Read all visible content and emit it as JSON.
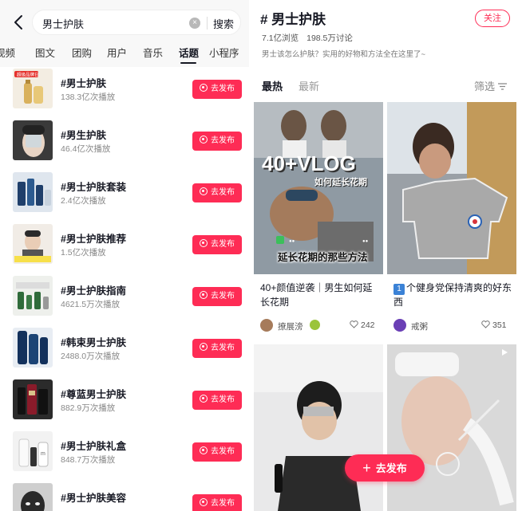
{
  "search": {
    "query": "男士护肤",
    "clear_icon": "clear-icon",
    "submit_label": "搜索"
  },
  "tabs": [
    "视频",
    "图文",
    "团购",
    "用户",
    "音乐",
    "话题",
    "小程序"
  ],
  "active_tab": "话题",
  "topics": [
    {
      "title": "#男士护肤",
      "plays": "138.3亿次播放",
      "button": "去发布"
    },
    {
      "title": "#男生护肤",
      "plays": "46.4亿次播放",
      "button": "去发布"
    },
    {
      "title": "#男士护肤套装",
      "plays": "2.4亿次播放",
      "button": "去发布"
    },
    {
      "title": "#男士护肤推荐",
      "plays": "1.5亿次播放",
      "button": "去发布"
    },
    {
      "title": "#男士护肤指南",
      "plays": "4621.5万次播放",
      "button": "去发布"
    },
    {
      "title": "#韩束男士护肤",
      "plays": "2488.0万次播放",
      "button": "去发布"
    },
    {
      "title": "#尊蓝男士护肤",
      "plays": "882.9万次播放",
      "button": "去发布"
    },
    {
      "title": "#男士护肤礼盒",
      "plays": "848.7万次播放",
      "button": "去发布"
    },
    {
      "title": "#男士护肤美容",
      "plays": "",
      "button": "去发布"
    }
  ],
  "thumb_labels": {
    "first_badge": "超级品牌日"
  },
  "topic_page": {
    "title": "# 男士护肤",
    "follow_label": "关注",
    "views": "7.1亿浏览",
    "discussions": "198.5万讨论",
    "description": "男士该怎么护肤？实用的好物和方法全在这里了~",
    "tabs": [
      "最热",
      "最新"
    ],
    "active_tab": "最热",
    "filter_label": "筛选"
  },
  "cards": [
    {
      "overlay_big": "40+VLOG",
      "overlay_sub": "如何延长花期",
      "overlay_bottom": "延长花期的那些方法",
      "title": "40+颜值逆袭｜男生如何延长花期",
      "author": "撩展滂",
      "likes": "242"
    },
    {
      "title_prefix": "1",
      "title": "个健身党保持清爽的好东西",
      "author": "戒粥",
      "likes": "351"
    },
    {
      "title": "",
      "author": "",
      "likes": ""
    },
    {
      "title": "",
      "author": "",
      "likes": ""
    }
  ],
  "fab_label": "去发布",
  "colors": {
    "accent": "#fe2c55",
    "text": "#161823",
    "muted": "#888888"
  }
}
